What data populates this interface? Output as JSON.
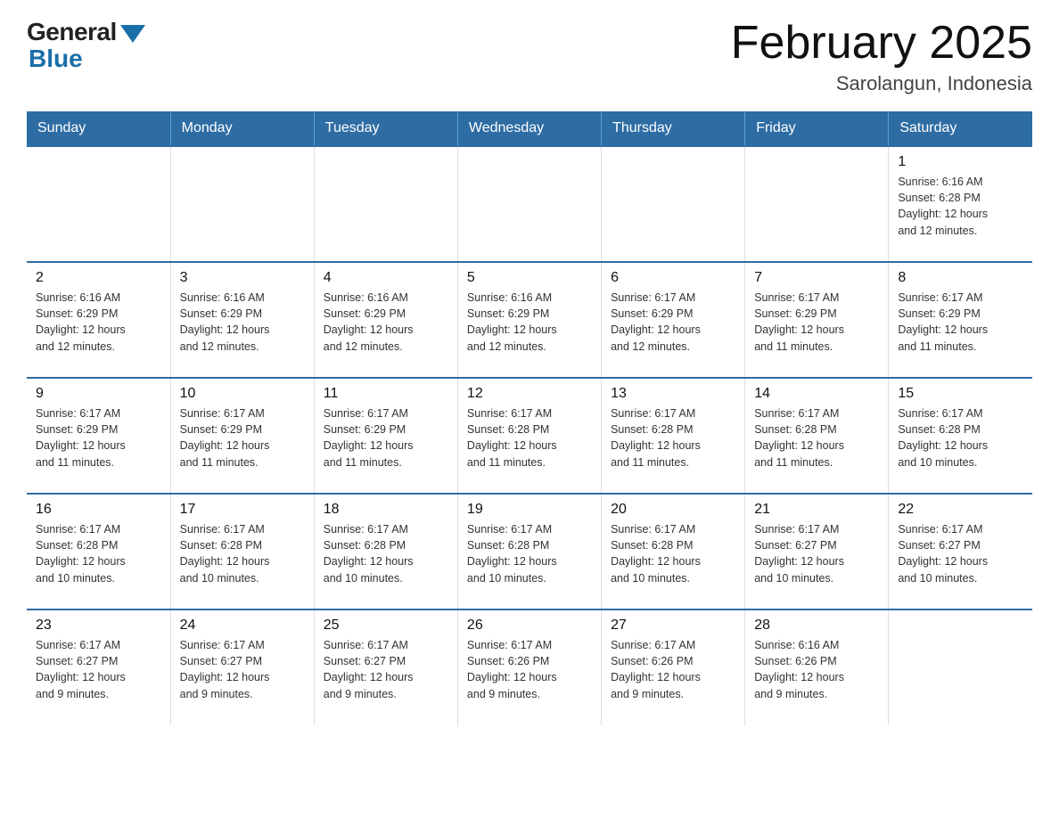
{
  "header": {
    "logo_general": "General",
    "logo_blue": "Blue",
    "month_title": "February 2025",
    "location": "Sarolangun, Indonesia"
  },
  "weekdays": [
    "Sunday",
    "Monday",
    "Tuesday",
    "Wednesday",
    "Thursday",
    "Friday",
    "Saturday"
  ],
  "weeks": [
    [
      {
        "day": "",
        "info": ""
      },
      {
        "day": "",
        "info": ""
      },
      {
        "day": "",
        "info": ""
      },
      {
        "day": "",
        "info": ""
      },
      {
        "day": "",
        "info": ""
      },
      {
        "day": "",
        "info": ""
      },
      {
        "day": "1",
        "info": "Sunrise: 6:16 AM\nSunset: 6:28 PM\nDaylight: 12 hours\nand 12 minutes."
      }
    ],
    [
      {
        "day": "2",
        "info": "Sunrise: 6:16 AM\nSunset: 6:29 PM\nDaylight: 12 hours\nand 12 minutes."
      },
      {
        "day": "3",
        "info": "Sunrise: 6:16 AM\nSunset: 6:29 PM\nDaylight: 12 hours\nand 12 minutes."
      },
      {
        "day": "4",
        "info": "Sunrise: 6:16 AM\nSunset: 6:29 PM\nDaylight: 12 hours\nand 12 minutes."
      },
      {
        "day": "5",
        "info": "Sunrise: 6:16 AM\nSunset: 6:29 PM\nDaylight: 12 hours\nand 12 minutes."
      },
      {
        "day": "6",
        "info": "Sunrise: 6:17 AM\nSunset: 6:29 PM\nDaylight: 12 hours\nand 12 minutes."
      },
      {
        "day": "7",
        "info": "Sunrise: 6:17 AM\nSunset: 6:29 PM\nDaylight: 12 hours\nand 11 minutes."
      },
      {
        "day": "8",
        "info": "Sunrise: 6:17 AM\nSunset: 6:29 PM\nDaylight: 12 hours\nand 11 minutes."
      }
    ],
    [
      {
        "day": "9",
        "info": "Sunrise: 6:17 AM\nSunset: 6:29 PM\nDaylight: 12 hours\nand 11 minutes."
      },
      {
        "day": "10",
        "info": "Sunrise: 6:17 AM\nSunset: 6:29 PM\nDaylight: 12 hours\nand 11 minutes."
      },
      {
        "day": "11",
        "info": "Sunrise: 6:17 AM\nSunset: 6:29 PM\nDaylight: 12 hours\nand 11 minutes."
      },
      {
        "day": "12",
        "info": "Sunrise: 6:17 AM\nSunset: 6:28 PM\nDaylight: 12 hours\nand 11 minutes."
      },
      {
        "day": "13",
        "info": "Sunrise: 6:17 AM\nSunset: 6:28 PM\nDaylight: 12 hours\nand 11 minutes."
      },
      {
        "day": "14",
        "info": "Sunrise: 6:17 AM\nSunset: 6:28 PM\nDaylight: 12 hours\nand 11 minutes."
      },
      {
        "day": "15",
        "info": "Sunrise: 6:17 AM\nSunset: 6:28 PM\nDaylight: 12 hours\nand 10 minutes."
      }
    ],
    [
      {
        "day": "16",
        "info": "Sunrise: 6:17 AM\nSunset: 6:28 PM\nDaylight: 12 hours\nand 10 minutes."
      },
      {
        "day": "17",
        "info": "Sunrise: 6:17 AM\nSunset: 6:28 PM\nDaylight: 12 hours\nand 10 minutes."
      },
      {
        "day": "18",
        "info": "Sunrise: 6:17 AM\nSunset: 6:28 PM\nDaylight: 12 hours\nand 10 minutes."
      },
      {
        "day": "19",
        "info": "Sunrise: 6:17 AM\nSunset: 6:28 PM\nDaylight: 12 hours\nand 10 minutes."
      },
      {
        "day": "20",
        "info": "Sunrise: 6:17 AM\nSunset: 6:28 PM\nDaylight: 12 hours\nand 10 minutes."
      },
      {
        "day": "21",
        "info": "Sunrise: 6:17 AM\nSunset: 6:27 PM\nDaylight: 12 hours\nand 10 minutes."
      },
      {
        "day": "22",
        "info": "Sunrise: 6:17 AM\nSunset: 6:27 PM\nDaylight: 12 hours\nand 10 minutes."
      }
    ],
    [
      {
        "day": "23",
        "info": "Sunrise: 6:17 AM\nSunset: 6:27 PM\nDaylight: 12 hours\nand 9 minutes."
      },
      {
        "day": "24",
        "info": "Sunrise: 6:17 AM\nSunset: 6:27 PM\nDaylight: 12 hours\nand 9 minutes."
      },
      {
        "day": "25",
        "info": "Sunrise: 6:17 AM\nSunset: 6:27 PM\nDaylight: 12 hours\nand 9 minutes."
      },
      {
        "day": "26",
        "info": "Sunrise: 6:17 AM\nSunset: 6:26 PM\nDaylight: 12 hours\nand 9 minutes."
      },
      {
        "day": "27",
        "info": "Sunrise: 6:17 AM\nSunset: 6:26 PM\nDaylight: 12 hours\nand 9 minutes."
      },
      {
        "day": "28",
        "info": "Sunrise: 6:16 AM\nSunset: 6:26 PM\nDaylight: 12 hours\nand 9 minutes."
      },
      {
        "day": "",
        "info": ""
      }
    ]
  ]
}
